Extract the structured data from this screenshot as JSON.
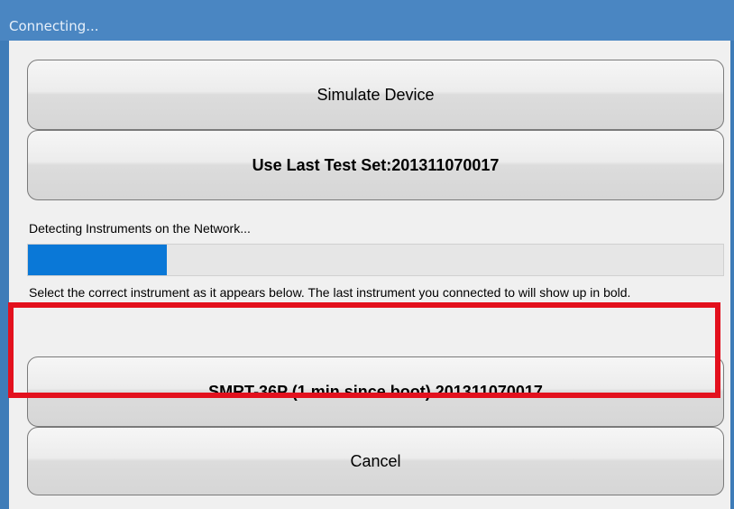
{
  "window": {
    "title": "Connecting..."
  },
  "buttons": {
    "simulate_label": "Simulate Device",
    "last_test_label": "Use Last Test Set:201311070017",
    "instrument_label": "SMRT-36P (1 min since boot) 201311070017",
    "cancel_label": "Cancel"
  },
  "status": {
    "detecting_text": "Detecting Instruments on the Network...",
    "progress_fraction": 0.2,
    "progress_color": "#0a78d7"
  },
  "instructions": {
    "text": "Select the correct instrument as it appears below. The last instrument you connected to will show up in bold."
  },
  "highlight": {
    "color": "#e3101d"
  }
}
